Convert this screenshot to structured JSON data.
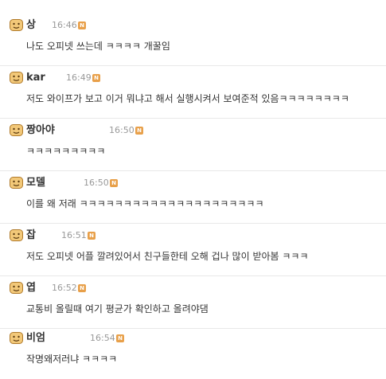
{
  "comments": [
    {
      "nickname": "상",
      "time": "16:46",
      "badge": "N",
      "text": "나도 오피넷 쓰는데 ㅋㅋㅋㅋ 개꿀임"
    },
    {
      "nickname": "kar",
      "time": "16:49",
      "badge": "N",
      "text": "저도 와이프가 보고 이거 뭐냐고 해서 실행시켜서 보여준적 있음ㅋㅋㅋㅋㅋㅋㅋㅋ"
    },
    {
      "nickname": "짱아야",
      "time": "16:50",
      "badge": "N",
      "text": "ㅋㅋㅋㅋㅋㅋㅋㅋㅋ"
    },
    {
      "nickname": "모델",
      "time": "16:50",
      "badge": "N",
      "text": "이를 왜 저래 ㅋㅋㅋㅋㅋㅋㅋㅋㅋㅋㅋㅋㅋㅋㅋㅋㅋㅋㅋㅋㅋ"
    },
    {
      "nickname": "잡",
      "time": "16:51",
      "badge": "N",
      "text": "저도 오피넷 어플 깔려있어서 친구들한테 오해 겁나 많이 받아봄 ㅋㅋㅋ"
    },
    {
      "nickname": "엽",
      "time": "16:52",
      "badge": "N",
      "text": "교통비 올릴때 여기 평균가 확인하고 올려야댐"
    },
    {
      "nickname": "비엄",
      "time": "16:54",
      "badge": "N",
      "text": "작명왜저러냐 ㅋㅋㅋㅋ"
    }
  ],
  "icons": {
    "avatar": "face-emoticon-icon",
    "badge": "new-badge-icon"
  },
  "colors": {
    "badge": "#e8a04a",
    "avatar_fill": "#f2c879",
    "time": "#999999",
    "text": "#333333"
  }
}
